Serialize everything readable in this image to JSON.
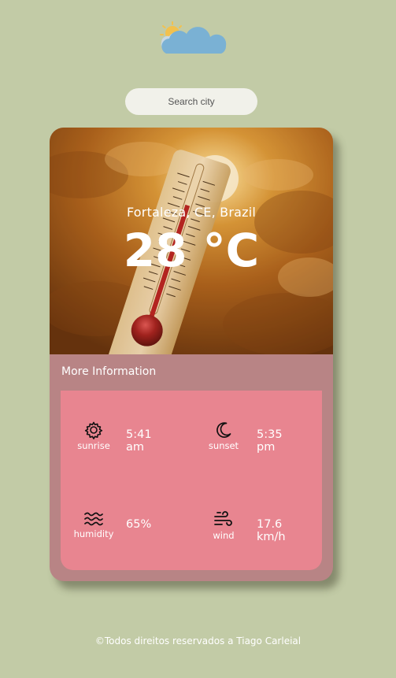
{
  "logo": {
    "icon": "cloud-sun-icon"
  },
  "search": {
    "placeholder": "Search city"
  },
  "weather": {
    "location": "Fortaleza, CE, Brazil",
    "temperature": "28 °C"
  },
  "more_info": {
    "title": "More Information",
    "sunrise": {
      "label": "sunrise",
      "value": "5:41 am",
      "icon": "sun-gear-icon"
    },
    "sunset": {
      "label": "sunset",
      "value": "5:35 pm",
      "icon": "moon-icon"
    },
    "humidity": {
      "label": "humidity",
      "value": "65%",
      "icon": "waves-icon"
    },
    "wind": {
      "label": "wind",
      "value": "17.6 km/h",
      "icon": "wind-icon"
    }
  },
  "footer": {
    "text": "©Todos direitos reservados a Tiago Carleial"
  },
  "colors": {
    "background": "#c2cba6",
    "card": "#b88485",
    "panel": "#e88590",
    "search": "#f1f1ea"
  }
}
